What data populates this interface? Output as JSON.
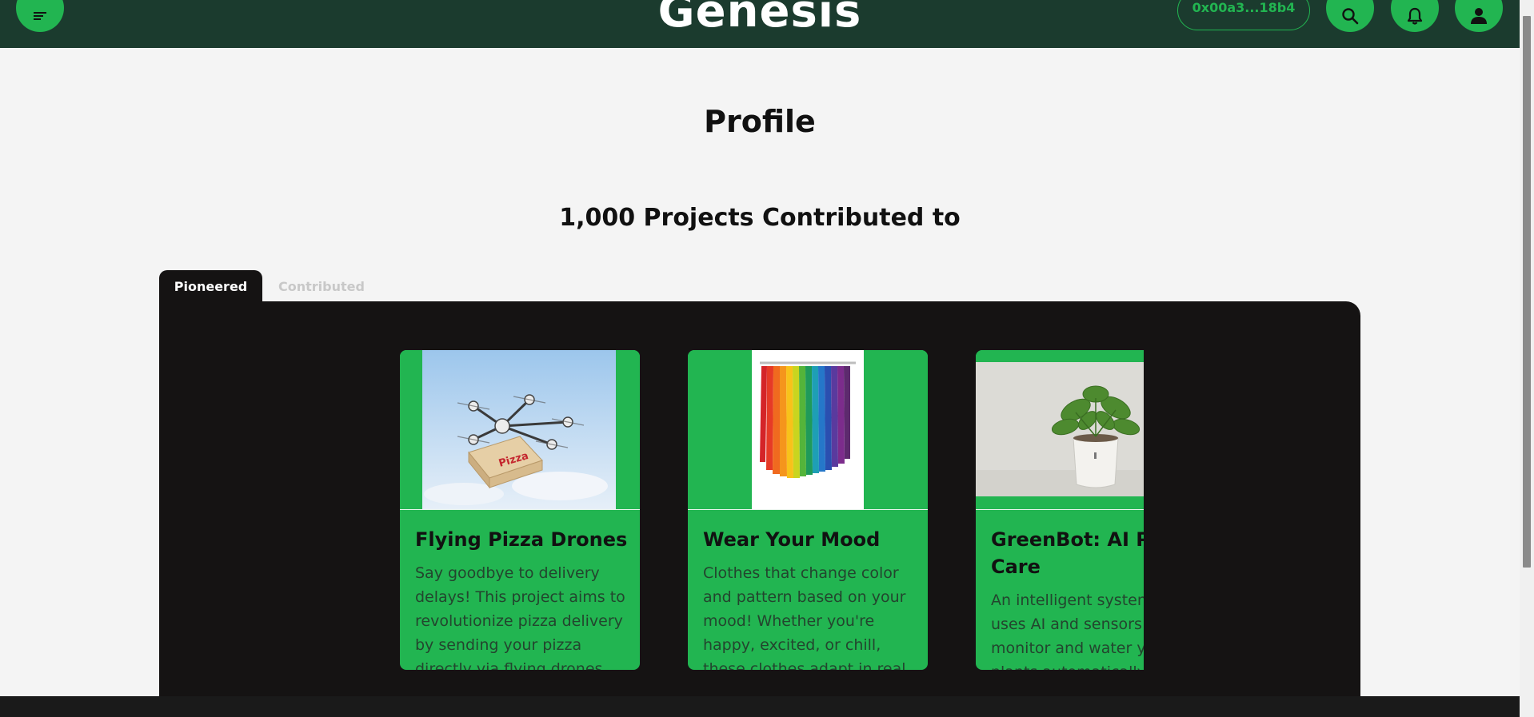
{
  "header": {
    "brand": "Genesis",
    "wallet_address": "0x00a3...18b4",
    "menu_icon": "menu-icon",
    "search_icon": "search-icon",
    "bell_icon": "bell-icon",
    "user_icon": "user-icon",
    "bg_color": "#1b3b2e",
    "accent_color": "#22b551"
  },
  "profile": {
    "title": "Profile",
    "projects_heading": "1,000 Projects Contributed to"
  },
  "tabs": [
    {
      "label": "Pioneered",
      "active": true
    },
    {
      "label": "Contributed",
      "active": false
    }
  ],
  "projects": [
    {
      "title": "Flying Pizza Drones",
      "description": "Say goodbye to delivery delays! This project aims to revolutionize pizza delivery by sending your pizza directly via flying drones.",
      "image": "drone-carrying-pizza-box-image"
    },
    {
      "title": "Wear Your Mood",
      "description": "Clothes that change color and pattern based on your mood! Whether you're happy, excited, or chill, these clothes adapt in real",
      "image": "rainbow-shirts-rack-image"
    },
    {
      "title": "GreenBot: AI Plant Care",
      "description": "An intelligent system that uses AI and sensors to monitor and water your plants automatically",
      "image": "potted-plant-image"
    }
  ]
}
